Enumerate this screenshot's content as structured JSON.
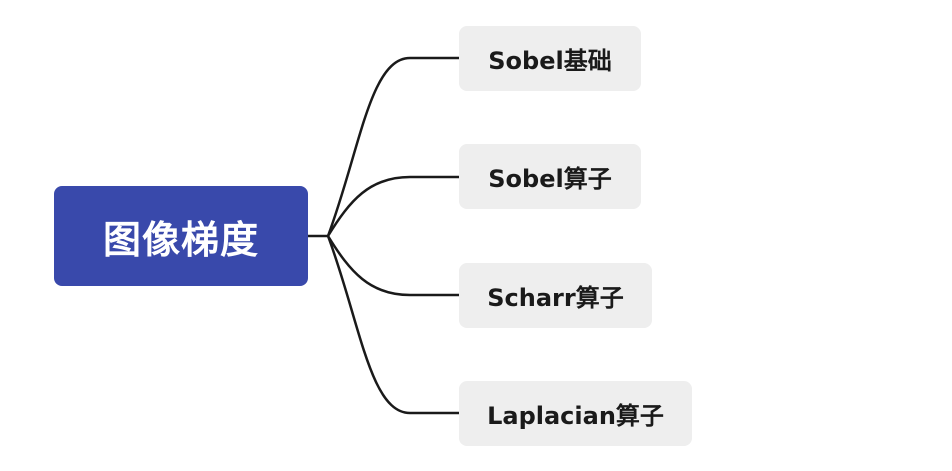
{
  "mindmap": {
    "root": {
      "label": "图像梯度",
      "color": "#3949ab"
    },
    "children": [
      {
        "label": "Sobel基础"
      },
      {
        "label": "Sobel算子"
      },
      {
        "label": "Scharr算子"
      },
      {
        "label": "Laplacian算子"
      }
    ],
    "connector_color": "#1a1a1a",
    "node_fill": "#eeeeee"
  }
}
